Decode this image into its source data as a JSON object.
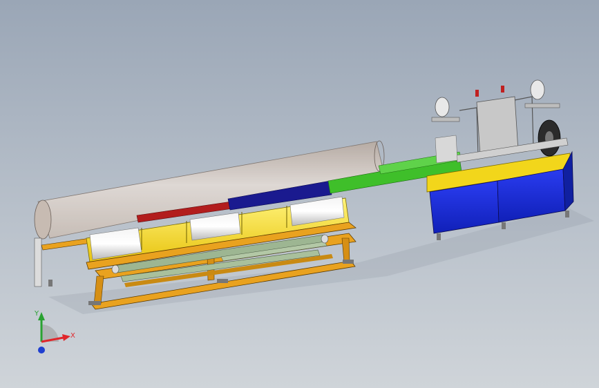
{
  "triad": {
    "x_label": "X",
    "y_label": "Y",
    "x_color": "#e0262b",
    "y_color": "#2aa232",
    "z_color": "#1f3fd0"
  },
  "colors": {
    "frame": "#e9a21f",
    "panel_yellow": "#f2d61b",
    "tube": "#d6cbc2",
    "rod_red": "#b21d1d",
    "rod_blue": "#1a1a8f",
    "rod_green": "#3fbf2a",
    "cabinet_blue": "#1628d8",
    "roller_green": "#9db692"
  }
}
